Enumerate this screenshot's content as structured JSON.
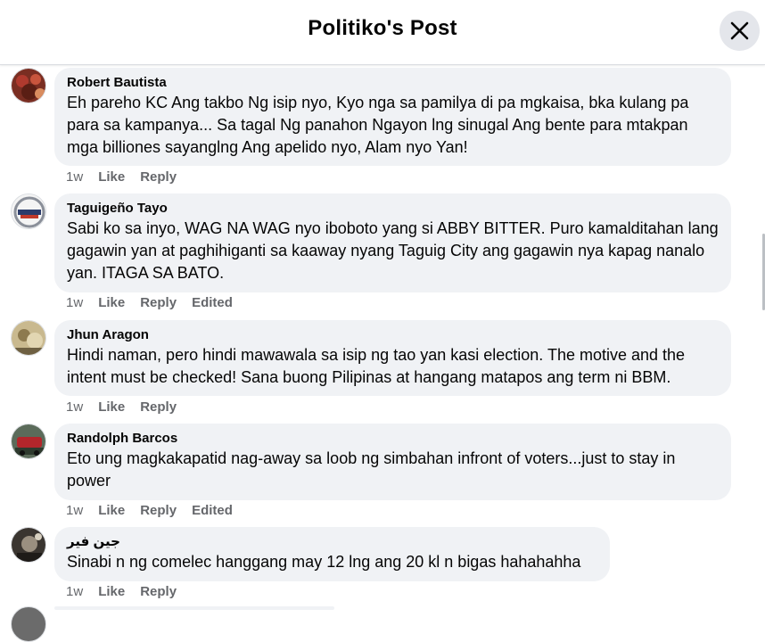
{
  "header": {
    "title": "Politiko's Post",
    "close_icon": "close-icon"
  },
  "comments": [
    {
      "author": "Robert Bautista",
      "text": "Eh pareho KC Ang takbo Ng isip nyo, Kyo nga sa pamilya di pa mgkaisa, bka kulang pa para sa kampanya... Sa tagal Ng panahon Ngayon lng sinugal Ang bente para mtakpan mga billiones sayanglng Ang apelido nyo, Alam nyo Yan!",
      "time": "1w",
      "like": "Like",
      "reply": "Reply",
      "edited": ""
    },
    {
      "author": "Taguigeño Tayo",
      "text": "Sabi ko sa inyo, WAG NA WAG nyo iboboto yang si ABBY BITTER. Puro kamalditahan lang gagawin yan at paghihiganti sa kaaway nyang Taguig City ang gagawin nya kapag nanalo yan. ITAGA SA BATO.",
      "time": "1w",
      "like": "Like",
      "reply": "Reply",
      "edited": "Edited"
    },
    {
      "author": "Jhun Aragon",
      "text": "Hindi naman, pero hindi mawawala sa isip ng tao yan kasi election. The motive and the intent must be checked! Sana buong Pilipinas at hangang matapos ang term ni BBM.",
      "time": "1w",
      "like": "Like",
      "reply": "Reply",
      "edited": ""
    },
    {
      "author": "Randolph Barcos",
      "text": "Eto ung magkakapatid nag-away sa loob ng simbahan infront of voters...just to stay in power",
      "time": "1w",
      "like": "Like",
      "reply": "Reply",
      "edited": "Edited"
    },
    {
      "author": "جين فير",
      "text": "Sinabi n ng comelec hanggang may 12 lng ang 20 kl n bigas hahahahha",
      "time": "1w",
      "like": "Like",
      "reply": "Reply",
      "edited": ""
    }
  ]
}
